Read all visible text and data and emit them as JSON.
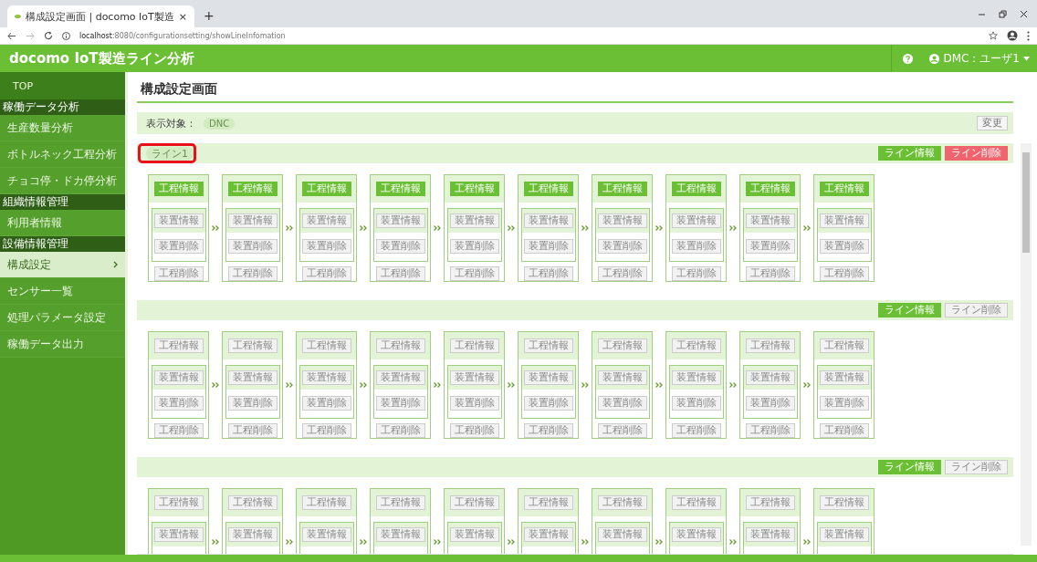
{
  "browser": {
    "tab_title": "構成設定画面 | docomo IoT製造",
    "tab_close": "×",
    "new_tab": "+",
    "url": "**localhost**:8080/configurationsetting/showLineInfomation"
  },
  "header": {
    "app_title": "docomo IoT製造ライン分析",
    "user": "DMC：ユーザ1"
  },
  "sidebar": {
    "items": [
      {
        "kind": "top",
        "label": "TOP",
        "selected": false
      },
      {
        "kind": "section",
        "label": "稼働データ分析"
      },
      {
        "kind": "link",
        "label": "生産数量分析",
        "selected": false
      },
      {
        "kind": "link",
        "label": "ボトルネック工程分析",
        "selected": false
      },
      {
        "kind": "link",
        "label": "チョコ停・ドカ停分析",
        "selected": false
      },
      {
        "kind": "section",
        "label": "組織情報管理"
      },
      {
        "kind": "link",
        "label": "利用者情報",
        "selected": false
      },
      {
        "kind": "section",
        "label": "設備情報管理"
      },
      {
        "kind": "link",
        "label": "構成設定",
        "selected": true
      },
      {
        "kind": "link",
        "label": "センサー一覧",
        "selected": false
      },
      {
        "kind": "link",
        "label": "処理パラメータ設定",
        "selected": false
      },
      {
        "kind": "link",
        "label": "稼働データ出力",
        "selected": false
      }
    ]
  },
  "page": {
    "title": "構成設定画面",
    "target_label": "表示対象：",
    "target_value": "DNC",
    "change_button": "変更"
  },
  "lines": [
    {
      "name": "ライン1",
      "selected": true,
      "annotated": true,
      "info_button": "ライン情報",
      "delete_button": "ライン削除",
      "processes": [
        {
          "info": "工程情報",
          "device_info": "装置情報",
          "device_delete": "装置削除",
          "delete": "工程削除"
        },
        {
          "info": "工程情報",
          "device_info": "装置情報",
          "device_delete": "装置削除",
          "delete": "工程削除"
        },
        {
          "info": "工程情報",
          "device_info": "装置情報",
          "device_delete": "装置削除",
          "delete": "工程削除"
        },
        {
          "info": "工程情報",
          "device_info": "装置情報",
          "device_delete": "装置削除",
          "delete": "工程削除"
        },
        {
          "info": "工程情報",
          "device_info": "装置情報",
          "device_delete": "装置削除",
          "delete": "工程削除"
        },
        {
          "info": "工程情報",
          "device_info": "装置情報",
          "device_delete": "装置削除",
          "delete": "工程削除"
        },
        {
          "info": "工程情報",
          "device_info": "装置情報",
          "device_delete": "装置削除",
          "delete": "工程削除"
        },
        {
          "info": "工程情報",
          "device_info": "装置情報",
          "device_delete": "装置削除",
          "delete": "工程削除"
        },
        {
          "info": "工程情報",
          "device_info": "装置情報",
          "device_delete": "装置削除",
          "delete": "工程削除"
        },
        {
          "info": "工程情報",
          "device_info": "装置情報",
          "device_delete": "装置削除",
          "delete": "工程削除"
        }
      ]
    },
    {
      "selected": false,
      "annotated": false,
      "info_button": "ライン情報",
      "delete_button": "ライン削除",
      "processes": [
        {
          "info": "工程情報",
          "device_info": "装置情報",
          "device_delete": "装置削除",
          "delete": "工程削除"
        },
        {
          "info": "工程情報",
          "device_info": "装置情報",
          "device_delete": "装置削除",
          "delete": "工程削除"
        },
        {
          "info": "工程情報",
          "device_info": "装置情報",
          "device_delete": "装置削除",
          "delete": "工程削除"
        },
        {
          "info": "工程情報",
          "device_info": "装置情報",
          "device_delete": "装置削除",
          "delete": "工程削除"
        },
        {
          "info": "工程情報",
          "device_info": "装置情報",
          "device_delete": "装置削除",
          "delete": "工程削除"
        },
        {
          "info": "工程情報",
          "device_info": "装置情報",
          "device_delete": "装置削除",
          "delete": "工程削除"
        },
        {
          "info": "工程情報",
          "device_info": "装置情報",
          "device_delete": "装置削除",
          "delete": "工程削除"
        },
        {
          "info": "工程情報",
          "device_info": "装置情報",
          "device_delete": "装置削除",
          "delete": "工程削除"
        },
        {
          "info": "工程情報",
          "device_info": "装置情報",
          "device_delete": "装置削除",
          "delete": "工程削除"
        },
        {
          "info": "工程情報",
          "device_info": "装置情報",
          "device_delete": "装置削除",
          "delete": "工程削除"
        }
      ]
    },
    {
      "selected": false,
      "annotated": false,
      "info_button": "ライン情報",
      "delete_button": "ライン削除",
      "processes": [
        {
          "info": "工程情報",
          "device_info": "装置情報"
        },
        {
          "info": "工程情報",
          "device_info": "装置情報"
        },
        {
          "info": "工程情報",
          "device_info": "装置情報"
        },
        {
          "info": "工程情報",
          "device_info": "装置情報"
        },
        {
          "info": "工程情報",
          "device_info": "装置情報"
        },
        {
          "info": "工程情報",
          "device_info": "装置情報"
        },
        {
          "info": "工程情報",
          "device_info": "装置情報"
        },
        {
          "info": "工程情報",
          "device_info": "装置情報"
        },
        {
          "info": "工程情報",
          "device_info": "装置情報"
        },
        {
          "info": "工程情報",
          "device_info": "装置情報"
        }
      ]
    }
  ]
}
